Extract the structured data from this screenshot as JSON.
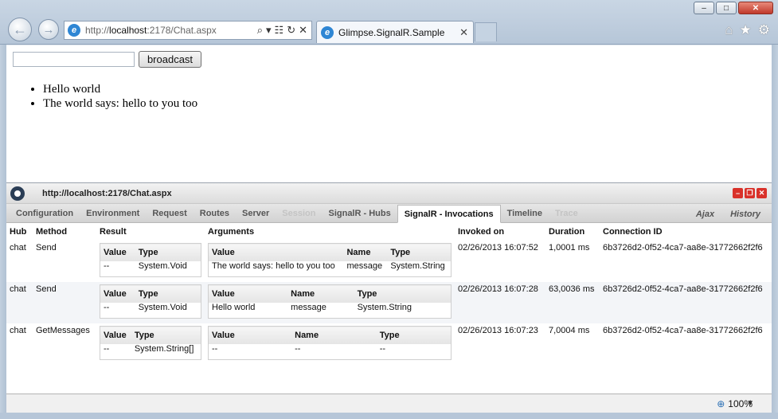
{
  "window": {
    "minimize": "–",
    "maximize": "□",
    "close": "✕"
  },
  "toolbar": {
    "back_icon": "←",
    "forward_icon": "→",
    "address_prefix": "http://",
    "address_host": "localhost",
    "address_rest": ":2178/Chat.aspx",
    "address_icons": [
      "⌕",
      "▾",
      "☷",
      "↻",
      "✕"
    ],
    "tab_title": "Glimpse.SignalR.Sample",
    "tab_close": "✕",
    "tool_icons": [
      "⌂",
      "★",
      "⚙"
    ]
  },
  "page": {
    "input_value": "",
    "button_label": "broadcast",
    "messages": [
      "Hello world",
      "The world says: hello to you too"
    ]
  },
  "glimpse": {
    "url": "http://localhost:2178/Chat.aspx",
    "tabs": [
      {
        "label": "Configuration",
        "state": "normal"
      },
      {
        "label": "Environment",
        "state": "normal"
      },
      {
        "label": "Request",
        "state": "normal"
      },
      {
        "label": "Routes",
        "state": "normal"
      },
      {
        "label": "Server",
        "state": "normal"
      },
      {
        "label": "Session",
        "state": "disabled"
      },
      {
        "label": "SignalR - Hubs",
        "state": "normal"
      },
      {
        "label": "SignalR - Invocations",
        "state": "active"
      },
      {
        "label": "Timeline",
        "state": "normal"
      },
      {
        "label": "Trace",
        "state": "disabled"
      }
    ],
    "right_tabs": [
      "Ajax",
      "History"
    ],
    "columns": [
      "Hub",
      "Method",
      "Result",
      "Arguments",
      "Invoked on",
      "Duration",
      "Connection ID"
    ],
    "result_headers": [
      "Value",
      "Type"
    ],
    "arg_headers": [
      "Value",
      "Name",
      "Type"
    ],
    "rows": [
      {
        "hub": "chat",
        "method": "Send",
        "result": {
          "value": "--",
          "type": "System.Void"
        },
        "args": [
          {
            "value": "The world says: hello to you too",
            "name": "message",
            "type": "System.String"
          }
        ],
        "invoked": "02/26/2013 16:07:52",
        "duration": "1,0001 ms",
        "conn": "6b3726d2-0f52-4ca7-aa8e-31772662f2f6"
      },
      {
        "hub": "chat",
        "method": "Send",
        "result": {
          "value": "--",
          "type": "System.Void"
        },
        "args": [
          {
            "value": "Hello world",
            "name": "message",
            "type": "System.String"
          }
        ],
        "invoked": "02/26/2013 16:07:28",
        "duration": "63,0036 ms",
        "conn": "6b3726d2-0f52-4ca7-aa8e-31772662f2f6"
      },
      {
        "hub": "chat",
        "method": "GetMessages",
        "result": {
          "value": "--",
          "type": "System.String[]"
        },
        "args": [
          {
            "value": "--",
            "name": "--",
            "type": "--"
          }
        ],
        "invoked": "02/26/2013 16:07:23",
        "duration": "7,0004 ms",
        "conn": "6b3726d2-0f52-4ca7-aa8e-31772662f2f6"
      }
    ]
  },
  "status": {
    "zoom": "100%",
    "zoom_icon": "⊕",
    "zoom_arrow": "▼"
  }
}
